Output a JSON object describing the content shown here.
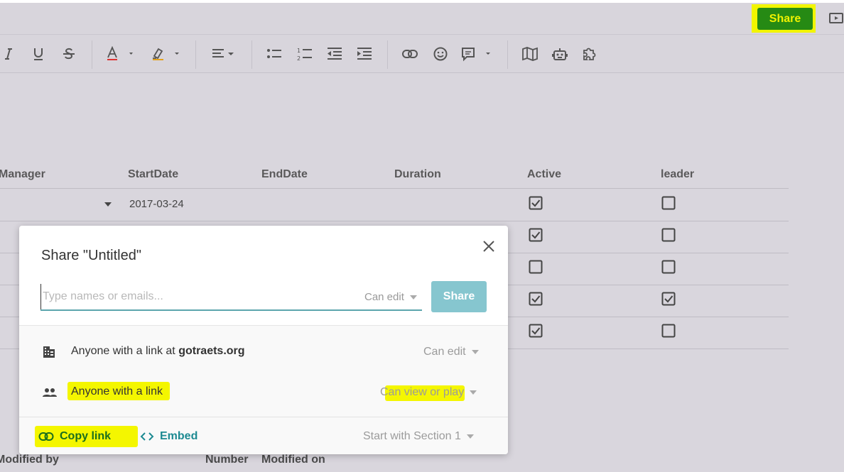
{
  "topbar": {
    "share_label": "Share",
    "present_icon": "present-icon"
  },
  "toolbar": {
    "items": [
      "italic-icon",
      "underline-icon",
      "strikethrough-icon",
      "text-color-icon",
      "highlight-color-icon",
      "align-icon",
      "bullet-list-icon",
      "numbered-list-icon",
      "outdent-icon",
      "indent-icon",
      "link-icon",
      "emoji-icon",
      "comment-icon",
      "map-icon",
      "robot-icon",
      "puzzle-icon"
    ]
  },
  "table": {
    "columns": [
      "Manager",
      "StartDate",
      "EndDate",
      "Duration",
      "Active",
      "leader"
    ],
    "rows": [
      {
        "start_date": "2017-03-24",
        "active": true,
        "leader": false
      },
      {
        "start_date": "",
        "active": true,
        "leader": false
      },
      {
        "start_date": "",
        "active": false,
        "leader": false
      },
      {
        "start_date": "",
        "active": true,
        "leader": true
      },
      {
        "start_date": "",
        "active": true,
        "leader": false
      }
    ]
  },
  "footer_columns": [
    "Modified by",
    "Number",
    "Modified on"
  ],
  "dialog": {
    "title": "Share \"Untitled\"",
    "invite": {
      "placeholder": "Type names or emails...",
      "permission": "Can edit",
      "share_label": "Share"
    },
    "rows": [
      {
        "icon": "domain-icon",
        "label_prefix": "Anyone with a link at ",
        "label_domain": "gotraets.org",
        "permission": "Can edit"
      },
      {
        "icon": "people-icon",
        "label": "Anyone with a link",
        "permission": "Can view or play"
      }
    ],
    "footer": {
      "copy_link": "Copy link",
      "embed": "Embed",
      "start_with": "Start with Section 1"
    },
    "colors": {
      "highlight": "#f4f600",
      "accent": "#1d8a92",
      "share_green": "#268a14"
    }
  }
}
